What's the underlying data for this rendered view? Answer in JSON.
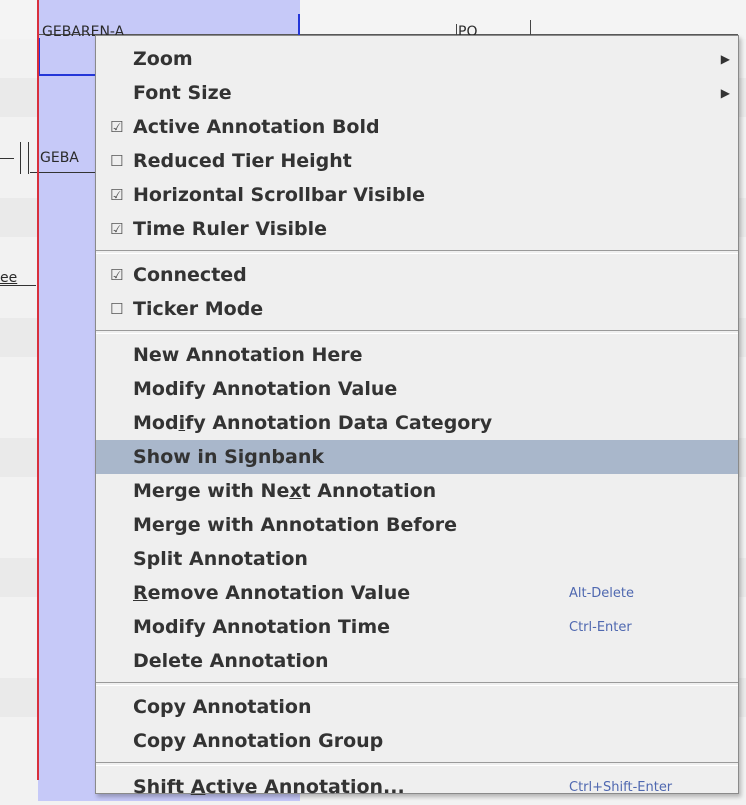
{
  "background": {
    "annotation_top": "GEBAREN-A",
    "annotation_mid": "GEBA",
    "annotation_bottom": "ee",
    "annotation_po": "PO"
  },
  "menu": {
    "items": [
      {
        "label": "Zoom",
        "submenu": true
      },
      {
        "label": "Font Size",
        "submenu": true
      },
      {
        "label": "Active Annotation Bold",
        "checked": true
      },
      {
        "label": "Reduced Tier Height",
        "checked": false
      },
      {
        "label": "Horizontal Scrollbar Visible",
        "checked": true
      },
      {
        "label": "Time Ruler Visible",
        "checked": true
      },
      {
        "label": "Connected",
        "checked": true
      },
      {
        "label": "Ticker Mode",
        "checked": false
      },
      {
        "label": "New Annotation Here"
      },
      {
        "label": "Modify Annotation Value"
      },
      {
        "label": "Modify Annotation Data Category",
        "mnemonic_prefix": "Mod",
        "mnemonic": "i",
        "mnemonic_suffix": "fy Annotation Data Category"
      },
      {
        "label": "Show in Signbank",
        "highlighted": true
      },
      {
        "label": "Merge with Next Annotation",
        "mnemonic_prefix": "Merge with Ne",
        "mnemonic": "x",
        "mnemonic_suffix": "t Annotation"
      },
      {
        "label": "Merge with Annotation Before"
      },
      {
        "label": "Split Annotation"
      },
      {
        "label": "Remove Annotation Value",
        "mnemonic_prefix": "",
        "mnemonic": "R",
        "mnemonic_suffix": "emove Annotation Value",
        "accelerator": "Alt-Delete"
      },
      {
        "label": "Modify Annotation Time",
        "accelerator": "Ctrl-Enter"
      },
      {
        "label": "Delete Annotation"
      },
      {
        "label": "Copy Annotation"
      },
      {
        "label": "Copy Annotation Group"
      },
      {
        "label": "Shift Active Annotation...",
        "mnemonic_prefix": "Shift ",
        "mnemonic": "A",
        "mnemonic_suffix": "ctive Annotation...",
        "accelerator": "Ctrl+Shift-Enter"
      }
    ],
    "check_on_glyph": "☑",
    "check_off_glyph": "☐",
    "submenu_glyph": "▶"
  },
  "colors": {
    "highlight": "#a9b7cb",
    "accelerator": "#4f68b0",
    "selection_band": "#c6c9f8",
    "crosshair": "#d8303c"
  }
}
